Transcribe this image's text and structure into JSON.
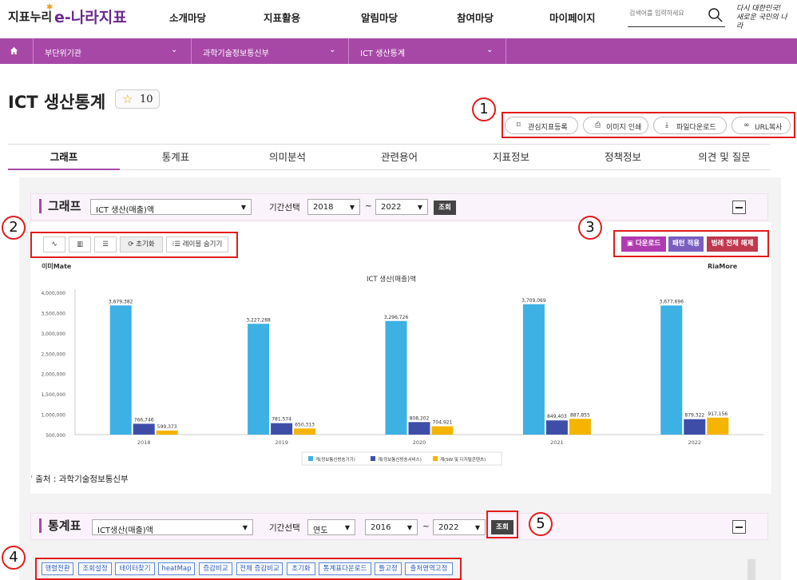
{
  "header": {
    "logo_primary": "지표누리",
    "logo_secondary": "e-나라지표",
    "nav": [
      "소개마당",
      "지표활용",
      "알림마당",
      "참여마당",
      "마이페이지"
    ],
    "search_placeholder": "검색어를 입력하세요",
    "slogan_line1": "다시 대한민국!",
    "slogan_line2": "새로운 국민의 나라"
  },
  "breadcrumb": {
    "items": [
      "부단위기관",
      "과학기술정보통신부",
      "ICT 생산통계"
    ]
  },
  "page": {
    "title": "ICT 생산통계",
    "favorite_count": "10"
  },
  "actions": [
    {
      "icon": "bookmark-icon",
      "glyph": "⌑",
      "label": "관심지표등록"
    },
    {
      "icon": "print-icon",
      "glyph": "⎙",
      "label": "이미지 인쇄"
    },
    {
      "icon": "download-icon",
      "glyph": "⤓",
      "label": "파일다운로드"
    },
    {
      "icon": "link-icon",
      "glyph": "∞",
      "label": "URL복사"
    }
  ],
  "tabs": [
    "그래프",
    "통계표",
    "의미분석",
    "관련용어",
    "지표정보",
    "정책정보",
    "의견 및 질문"
  ],
  "annotations": [
    "1",
    "2",
    "3",
    "4",
    "5"
  ],
  "graph_section": {
    "title": "그래프",
    "series_select": "ICT 생산(매출)액",
    "period_label": "기간선택",
    "from_year": "2018",
    "tilde": "~",
    "to_year": "2022",
    "query_button": "조회",
    "tools": {
      "line_glyph": "∿",
      "bar_glyph": "▥",
      "hbar_glyph": "☰",
      "reset_label": "초기화",
      "reset_glyph": "⟳",
      "hide_labels": "레이블 숨기기",
      "hide_glyph": "⁝☰"
    },
    "download_button": "다운로드",
    "download_glyph": "▣",
    "pattern_button": "패턴 적용",
    "legend_release_button": "범례 전체 해제",
    "brand_left": "이미Mate",
    "brand_right": "RiaMore",
    "source": "출처 : 과학기술정보통신부"
  },
  "chart_data": {
    "type": "bar",
    "title": "ICT 생산(매출)액",
    "categories": [
      "2018",
      "2019",
      "2020",
      "2021",
      "2022"
    ],
    "series": [
      {
        "name": "계(정보통신방송기기)",
        "color": "#3db0e4",
        "values": [
          3679382,
          3227288,
          3296726,
          3709069,
          3677696
        ]
      },
      {
        "name": "계(정보통신방송서비스)",
        "color": "#3e4ea8",
        "values": [
          766746,
          781574,
          808202,
          849403,
          879322
        ]
      },
      {
        "name": "계(SW 및 디지털콘텐츠)",
        "color": "#f5b400",
        "values": [
          599373,
          650313,
          704921,
          887855,
          917156
        ]
      }
    ],
    "data_labels": [
      [
        "3,679,382",
        "766,746",
        "599,373"
      ],
      [
        "3,227,288",
        "781,574",
        "650,313"
      ],
      [
        "3,296,726",
        "808,202",
        "704,921"
      ],
      [
        "3,709,069",
        "849,403",
        "887,855"
      ],
      [
        "3,677,696",
        "879,322",
        "917,156"
      ]
    ],
    "y_ticks": [
      "4,000,000",
      "3,500,000",
      "3,000,000",
      "2,500,000",
      "2,000,000",
      "1,500,000",
      "1,000,000",
      "500,000"
    ],
    "ylim": [
      500000,
      4000000
    ],
    "legend_position": "bottom-center",
    "grid": false
  },
  "table_section": {
    "title": "통계표",
    "series_select": "ICT생산(매출)액",
    "period_label": "기간선택",
    "period_unit": "연도",
    "from_year": "2016",
    "tilde": "~",
    "to_year": "2022",
    "query_button": "조회",
    "buttons": [
      "행렬전환",
      "조회설정",
      "테이터찾기",
      "heatMap",
      "증감비교",
      "전체 증감비교",
      "초기화",
      "통계표다운로드",
      "틀고정",
      "출처영역고정"
    ]
  }
}
